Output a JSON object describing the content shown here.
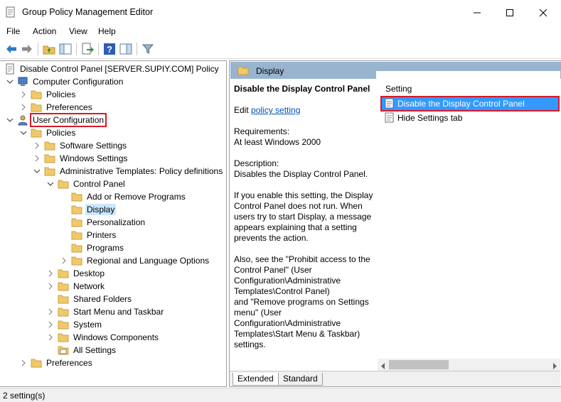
{
  "window": {
    "title": "Group Policy Management Editor"
  },
  "menu": [
    "File",
    "Action",
    "View",
    "Help"
  ],
  "tree": {
    "root": "Disable Control Panel [SERVER.SUPIY.COM] Policy",
    "computer_configuration": "Computer Configuration",
    "computer_policies": "Policies",
    "computer_preferences": "Preferences",
    "user_configuration": "User Configuration",
    "user_policies": "Policies",
    "software_settings": "Software Settings",
    "windows_settings": "Windows Settings",
    "administrative_templates": "Administrative Templates: Policy definitions",
    "control_panel": "Control Panel",
    "add_remove_programs": "Add or Remove Programs",
    "display": "Display",
    "personalization": "Personalization",
    "printers": "Printers",
    "programs": "Programs",
    "regional_language": "Regional and Language Options",
    "desktop": "Desktop",
    "network": "Network",
    "shared_folders": "Shared Folders",
    "start_menu_taskbar": "Start Menu and Taskbar",
    "system": "System",
    "windows_components": "Windows Components",
    "all_settings": "All Settings",
    "user_preferences": "Preferences"
  },
  "right": {
    "header": "Display",
    "desc_title": "Disable the Display Control Panel",
    "edit_prefix": "Edit ",
    "edit_link": "policy setting",
    "requirements_label": "Requirements:",
    "requirements_value": "At least Windows 2000",
    "description_label": "Description:",
    "description_value": "Disables the Display Control Panel.",
    "para1": "If you enable this setting, the Display Control Panel does not run. When users try to start Display, a message appears explaining that a setting prevents the action.",
    "para2_l1": "Also, see the \"Prohibit access to the Control Panel\" (User Configuration\\Administrative Templates\\Control Panel)",
    "para2_l2": "and \"Remove programs on Settings menu\" (User Configuration\\Administrative Templates\\Start Menu & Taskbar) settings.",
    "column_header": "Setting",
    "settings": [
      "Disable the Display Control Panel",
      "Hide Settings tab"
    ],
    "tabs": [
      "Extended",
      "Standard"
    ]
  },
  "status": {
    "text": "2 setting(s)"
  }
}
